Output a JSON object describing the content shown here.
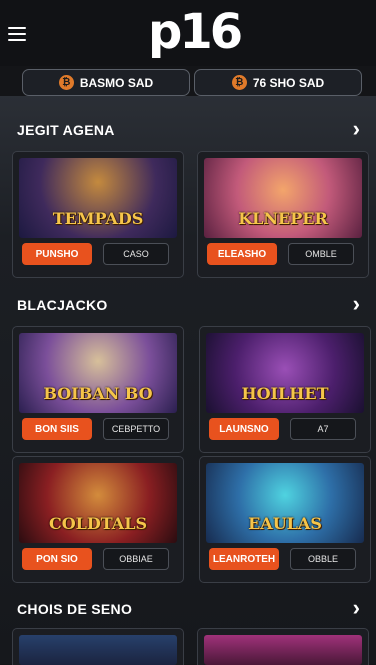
{
  "header": {
    "logo_text": "p16"
  },
  "balances": [
    {
      "icon": "coin-icon",
      "coin_symbol": "₿",
      "label": "BASMO SAD"
    },
    {
      "icon": "coin-icon",
      "coin_symbol": "₿",
      "label": "76 SHO SAD"
    }
  ],
  "sections": [
    {
      "title": "JEGIT AGENA",
      "cards": [
        {
          "thumb_title": "TEMPADS",
          "play_label": "PUNSHO",
          "alt_label": "CASO"
        },
        {
          "thumb_title": "KLNEPER",
          "play_label": "ELEASHO",
          "alt_label": "OMBLE"
        }
      ]
    },
    {
      "title": "BLACJACKO",
      "cards": [
        {
          "thumb_title": "BOIBAN BO",
          "play_label": "BON SIIS",
          "alt_label": "CEBPETTO"
        },
        {
          "thumb_title": "HOILHET",
          "play_label": "LAUNSNO",
          "alt_label": "A7"
        },
        {
          "thumb_title": "COLDTALS",
          "play_label": "PON SIO",
          "alt_label": "OBBIAE"
        },
        {
          "thumb_title": "EAULAS",
          "play_label": "LEANROTEH",
          "alt_label": "OBBLE"
        }
      ]
    },
    {
      "title": "CHOIS DE SENO",
      "cards": []
    }
  ],
  "colors": {
    "accent": "#e8521e",
    "background": "#141518",
    "card_border": "#3a3e46"
  }
}
